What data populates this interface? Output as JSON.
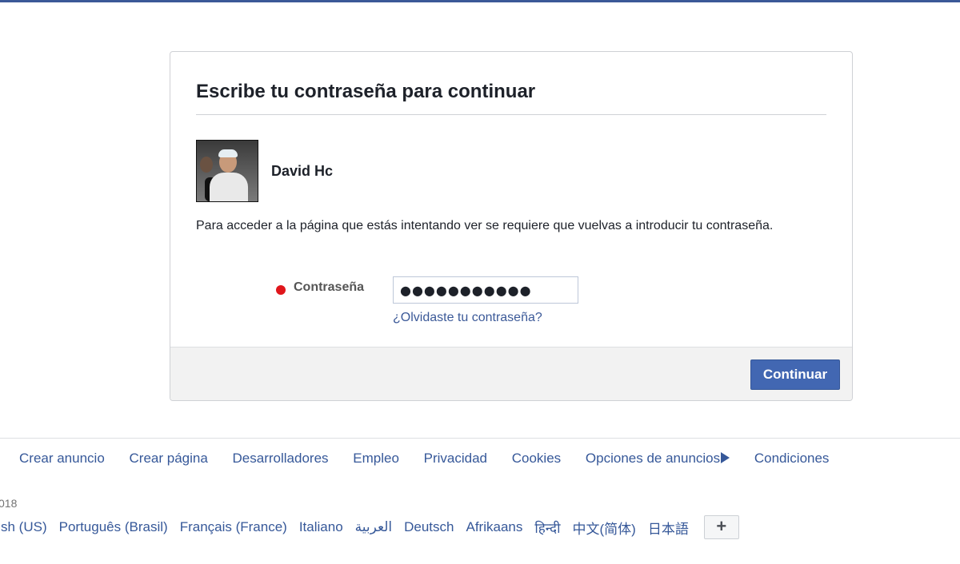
{
  "dialog": {
    "title": "Escribe tu contraseña para continuar",
    "profile": {
      "name": "David Hc",
      "avatar_icon": "profile-photo"
    },
    "message": "Para acceder a la página que estás intentando ver se requiere que vuelvas a introducir tu contraseña.",
    "password": {
      "label": "Contraseña",
      "value": "●●●●●●●●●●●",
      "required_marker_color": "#e0161b"
    },
    "forgot_link": "¿Olvidaste tu contraseña?",
    "continue_label": "Continuar"
  },
  "footer": {
    "links": [
      "Crear anuncio",
      "Crear página",
      "Desarrolladores",
      "Empleo",
      "Privacidad",
      "Cookies",
      "Opciones de anuncios",
      "Condiciones"
    ],
    "adchoices_icon": "adchoices-icon",
    "copyright": "018",
    "languages": [
      "glish (US)",
      "Português (Brasil)",
      "Français (France)",
      "Italiano",
      "العربية",
      "Deutsch",
      "Afrikaans",
      "हिन्दी",
      "中文(简体)",
      "日本語"
    ],
    "more_languages_label": "+"
  },
  "colors": {
    "brand": "#3b5998",
    "button": "#4267b2",
    "link": "#365899"
  }
}
